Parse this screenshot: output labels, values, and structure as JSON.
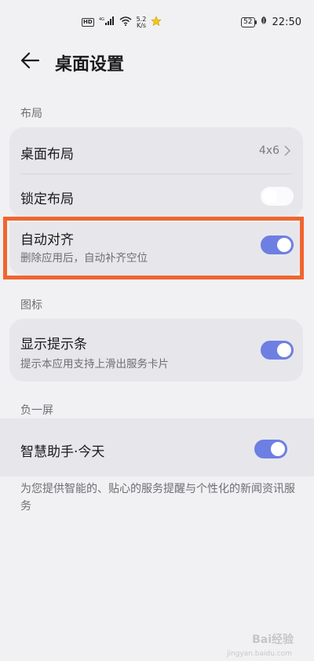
{
  "status_bar": {
    "hd": "HD",
    "net_type": "4G",
    "net_speed_value": "5.2",
    "net_speed_unit": "K/s",
    "battery": "52",
    "time": "22:50"
  },
  "header": {
    "title": "桌面设置"
  },
  "sections": {
    "layout_label": "布局",
    "icons_label": "图标",
    "minus_one_label": "负一屏"
  },
  "layout_card": {
    "desktop_layout": {
      "title": "桌面布局",
      "value": "4x6"
    },
    "lock_layout": {
      "title": "锁定布局",
      "enabled": false
    }
  },
  "auto_align": {
    "title": "自动对齐",
    "subtitle": "删除应用后，自动补齐空位",
    "enabled": true
  },
  "icons_card": {
    "show_bar": {
      "title": "显示提示条",
      "subtitle": "提示本应用支持上滑出服务卡片",
      "enabled": true
    }
  },
  "smart_assistant": {
    "title": "智慧助手·今天",
    "enabled": true
  },
  "footnote": "为您提供智能的、贴心的服务提醒与个性化的新闻资讯服务",
  "watermark": {
    "text": "Bai经验",
    "url": "jingyan.baidu.com"
  },
  "colors": {
    "accent": "#6d7fe3",
    "highlight": "#f0652f",
    "background": "#f1f1f3",
    "card": "#e7e7eb"
  }
}
